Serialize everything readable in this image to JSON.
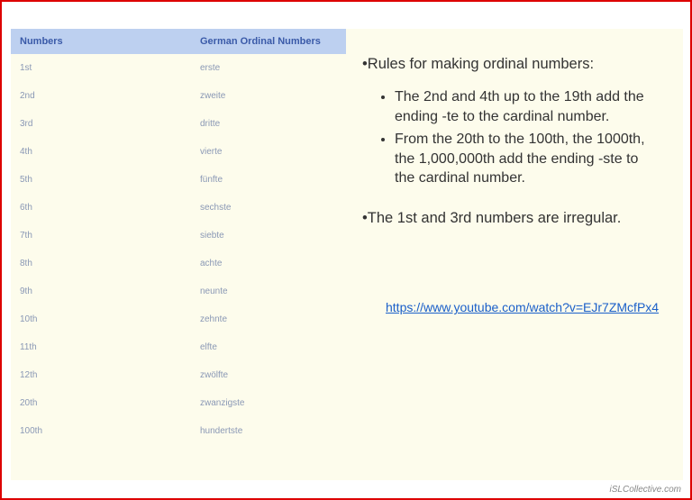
{
  "table": {
    "headers": {
      "col1": "Numbers",
      "col2": "German Ordinal Numbers"
    },
    "rows": [
      {
        "num": "1st",
        "german": "erste"
      },
      {
        "num": "2nd",
        "german": "zweite"
      },
      {
        "num": "3rd",
        "german": "dritte"
      },
      {
        "num": "4th",
        "german": "vierte"
      },
      {
        "num": "5th",
        "german": "fünfte"
      },
      {
        "num": "6th",
        "german": "sechste"
      },
      {
        "num": "7th",
        "german": "siebte"
      },
      {
        "num": "8th",
        "german": "achte"
      },
      {
        "num": "9th",
        "german": "neunte"
      },
      {
        "num": "10th",
        "german": "zehnte"
      },
      {
        "num": "11th",
        "german": "elfte"
      },
      {
        "num": "12th",
        "german": "zwölfte"
      },
      {
        "num": "20th",
        "german": "zwanzigste"
      },
      {
        "num": "100th",
        "german": "hundertste"
      }
    ]
  },
  "rules": {
    "title": "•Rules for making ordinal numbers:",
    "items": [
      "The 2nd and 4th up to the 19th add the ending -te to the cardinal number.",
      "From the 20th to the 100th, the 1000th, the 1,000,000th add the ending -ste to the cardinal number."
    ],
    "irregular": "•The 1st and 3rd numbers are irregular."
  },
  "link": {
    "url": "https://www.youtube.com/watch?v=EJr7ZMcfPx4"
  },
  "watermark": "iSLCollective.com"
}
